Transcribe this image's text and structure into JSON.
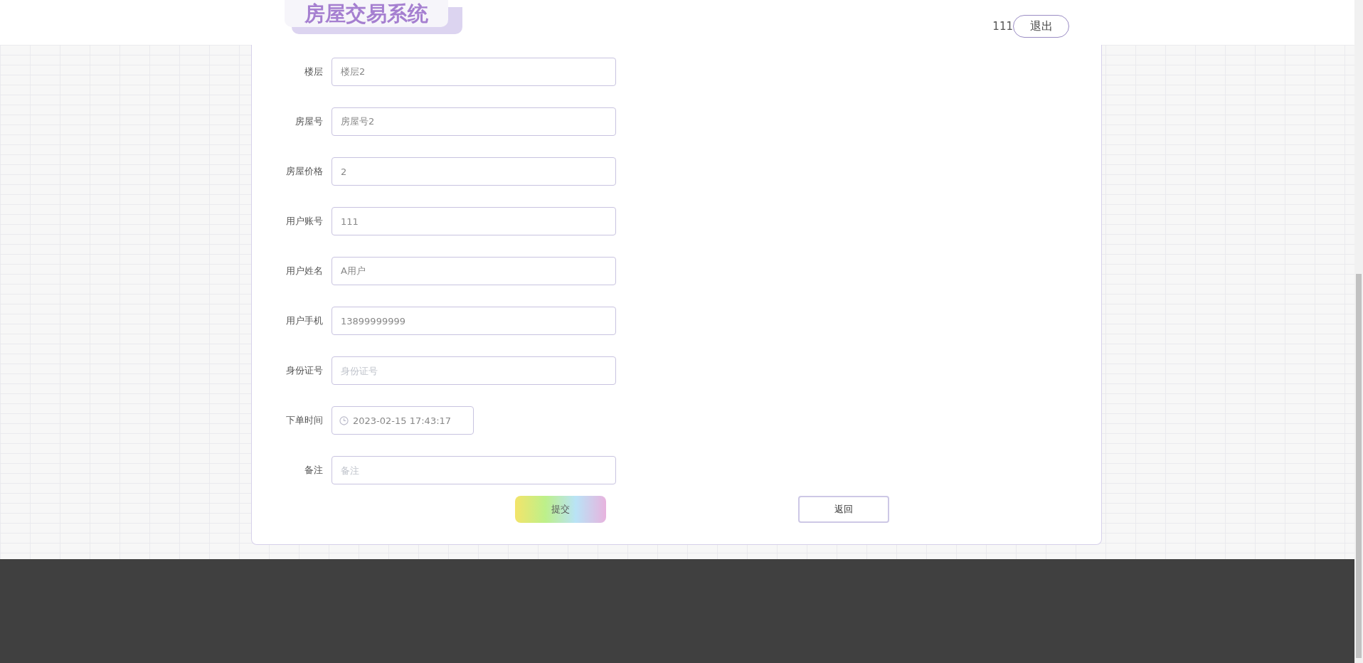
{
  "header": {
    "title": "房屋交易系统",
    "username": "111",
    "logout_button": "退出"
  },
  "form": {
    "fields": [
      {
        "kind": "text",
        "label": "楼层",
        "value": "楼层2"
      },
      {
        "kind": "text",
        "label": "房屋号",
        "value": "房屋号2"
      },
      {
        "kind": "text",
        "label": "房屋价格",
        "value": "2"
      },
      {
        "kind": "text",
        "label": "用户账号",
        "value": "111"
      },
      {
        "kind": "text",
        "label": "用户姓名",
        "value": "A用户"
      },
      {
        "kind": "text",
        "label": "用户手机",
        "value": "13899999999"
      },
      {
        "kind": "text",
        "label": "身份证号",
        "placeholder": "身份证号"
      },
      {
        "kind": "datetime",
        "label": "下单时间",
        "value": "2023-02-15 17:43:17"
      },
      {
        "kind": "text",
        "label": "备注",
        "placeholder": "备注"
      }
    ],
    "buttons": [
      {
        "kind": "submit",
        "label": "提交"
      },
      {
        "kind": "back",
        "label": "返回"
      }
    ]
  }
}
